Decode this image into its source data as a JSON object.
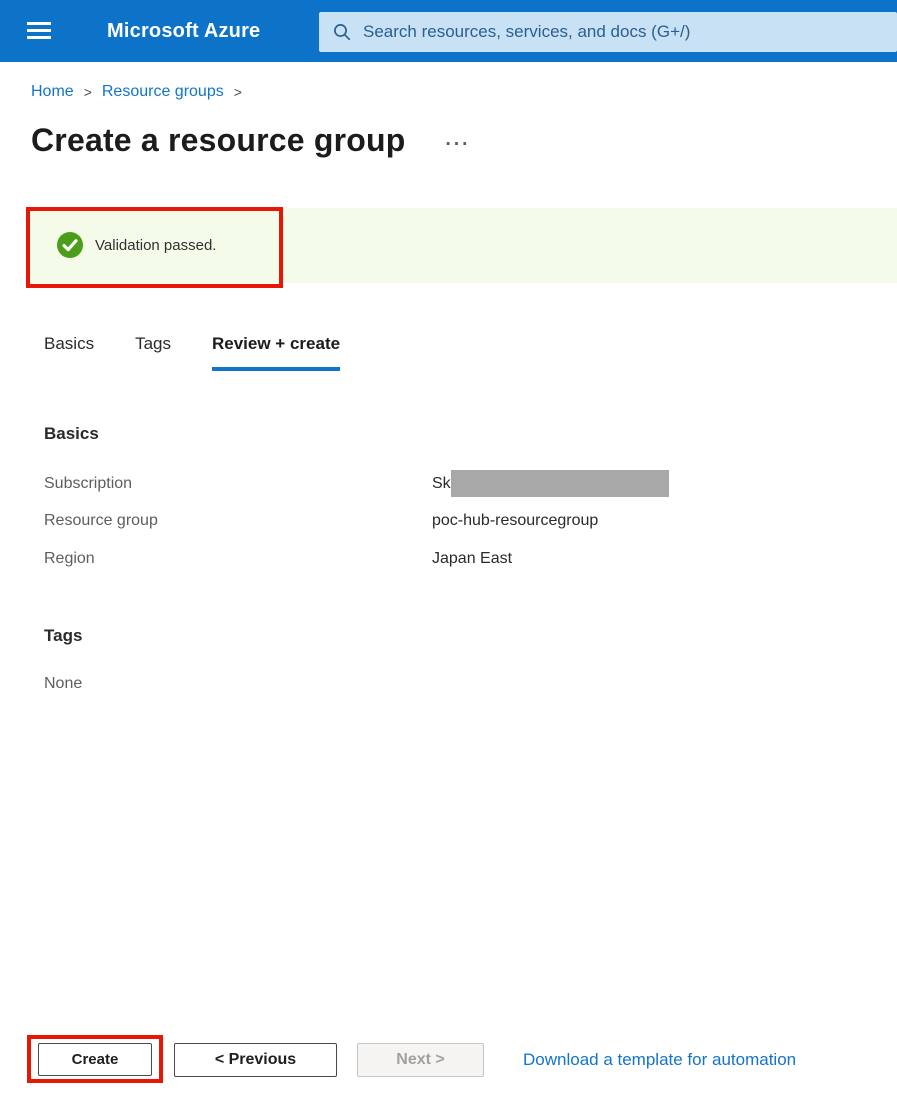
{
  "header": {
    "brand": "Microsoft Azure",
    "search_placeholder": "Search resources, services, and docs (G+/)"
  },
  "breadcrumb": {
    "items": [
      {
        "label": "Home"
      },
      {
        "label": "Resource groups"
      }
    ],
    "separator": ">"
  },
  "page": {
    "title": "Create a resource group",
    "more_options": "···"
  },
  "banner": {
    "message": "Validation passed."
  },
  "tabs": [
    {
      "label": "Basics",
      "active": false
    },
    {
      "label": "Tags",
      "active": false
    },
    {
      "label": "Review + create",
      "active": true
    }
  ],
  "sections": {
    "basics": {
      "heading": "Basics",
      "rows": [
        {
          "label": "Subscription",
          "value": "Sk",
          "redacted": true
        },
        {
          "label": "Resource group",
          "value": "poc-hub-resourcegroup",
          "redacted": false
        },
        {
          "label": "Region",
          "value": "Japan East",
          "redacted": false
        }
      ]
    },
    "tags": {
      "heading": "Tags",
      "value": "None"
    }
  },
  "footer": {
    "create_label": "Create",
    "previous_label": "< Previous",
    "next_label": "Next >",
    "automation_link": "Download a template for automation"
  },
  "icons": {
    "menu": "hamburger-three-lines",
    "search": "magnifier",
    "success_check": "check-in-green-circle",
    "more_options": "horizontal-ellipsis",
    "breadcrumb_separator": "chevron-right"
  },
  "colors": {
    "header_blue": "#0d73c8",
    "searchbox_blue": "#c9e1f4",
    "link_blue": "#1374cc",
    "success_green": "#4a9e1a",
    "banner_bg": "#f5fbe9",
    "annotation_red": "#e81604",
    "redaction_gray": "#a8a8a8"
  }
}
